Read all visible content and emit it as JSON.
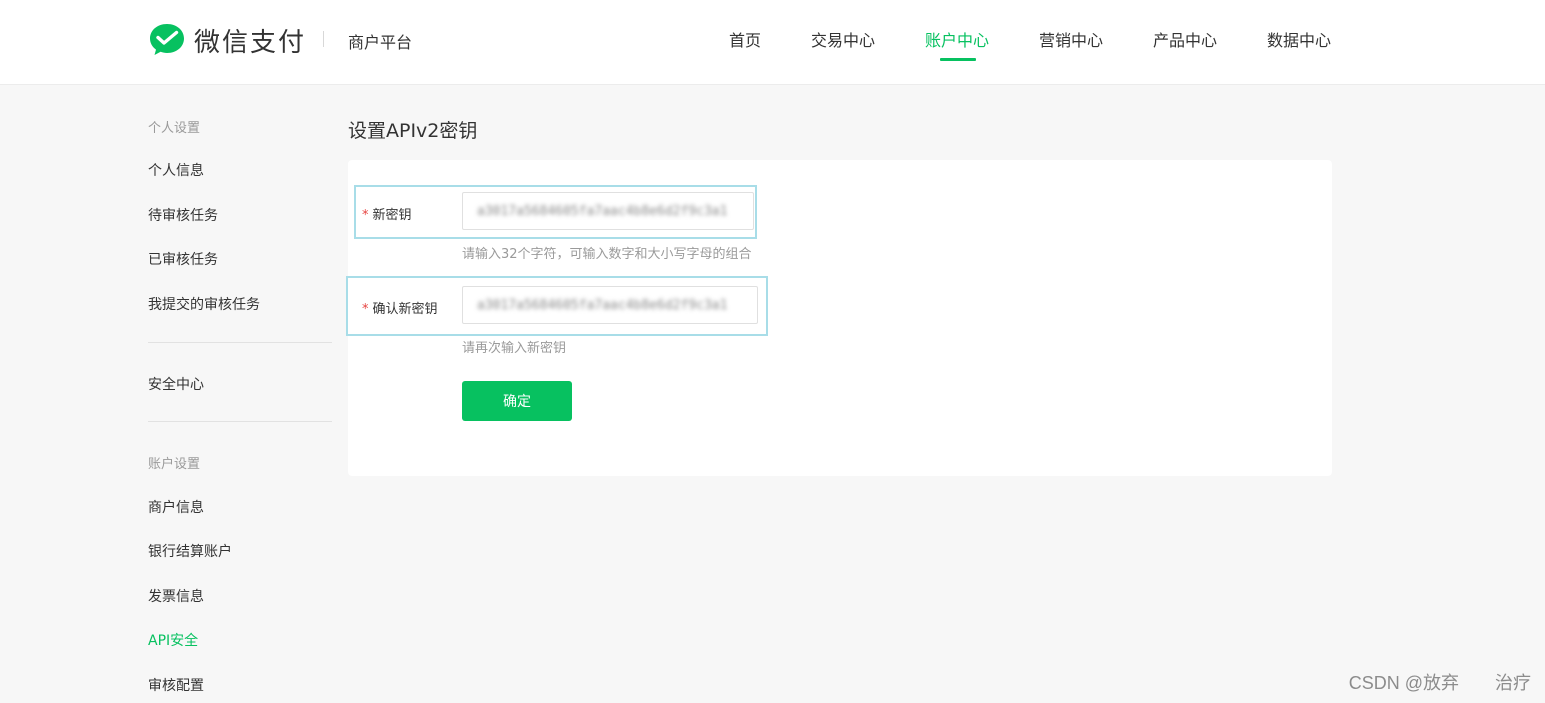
{
  "header": {
    "logo_text": "微信支付",
    "platform": "商户平台",
    "nav": [
      "首页",
      "交易中心",
      "账户中心",
      "营销中心",
      "产品中心",
      "数据中心"
    ],
    "active_nav": "账户中心",
    "accent_color": "#07c160"
  },
  "sidebar": {
    "group1": "个人设置",
    "personal_info": "个人信息",
    "pending_review": "待审核任务",
    "reviewed": "已审核任务",
    "my_submitted": "我提交的审核任务",
    "security_center": "安全中心",
    "group2": "账户设置",
    "merchant_info": "商户信息",
    "bank_account": "银行结算账户",
    "invoice_info": "发票信息",
    "api_security": "API安全",
    "review_config": "审核配置",
    "active_item": "API安全"
  },
  "main": {
    "title": "设置APIv2密钥",
    "new_key": {
      "required_mark": "*",
      "label": "新密钥",
      "value": "a3017a5684605fa7aac4b8e6d2f9c3a1",
      "hint": "请输入32个字符，可输入数字和大小写字母的组合"
    },
    "confirm_key": {
      "required_mark": "*",
      "label": "确认新密钥",
      "value": "a3017a5684605fa7aac4b8e6d2f9c3a1",
      "hint": "请再次输入新密钥"
    },
    "confirm_button": "确定"
  },
  "watermark": "CSDN @放弃　　治疗"
}
